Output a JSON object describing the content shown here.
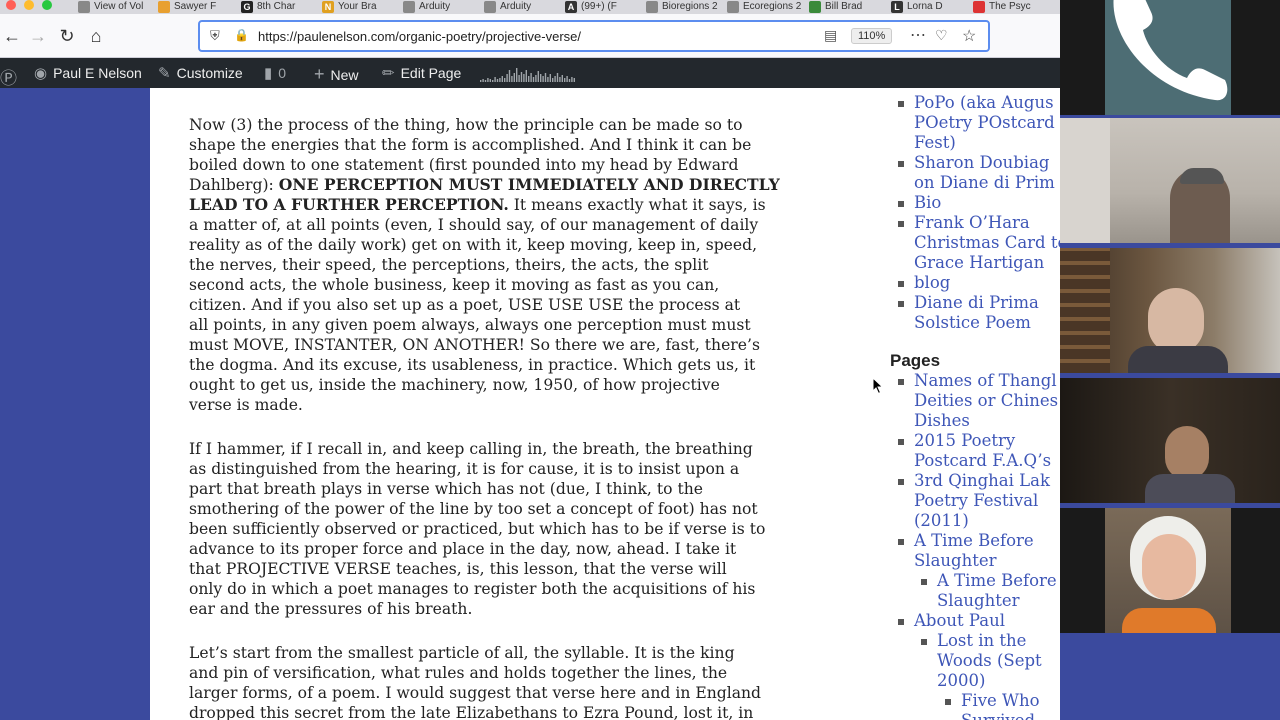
{
  "browser": {
    "tabs": [
      {
        "label": "View of Vol",
        "favicon": "",
        "color": "#888"
      },
      {
        "label": "Sawyer F",
        "favicon": "",
        "color": "#e8a030"
      },
      {
        "label": "8th Char",
        "favicon": "G",
        "color": "#222"
      },
      {
        "label": "Your Bra",
        "favicon": "N",
        "color": "#e0a020"
      },
      {
        "label": "Arduity",
        "favicon": "",
        "color": "#888"
      },
      {
        "label": "Arduity",
        "favicon": "",
        "color": "#888"
      },
      {
        "label": "(99+) (F",
        "favicon": "A",
        "color": "#333"
      },
      {
        "label": "Bioregions 2",
        "favicon": "",
        "color": "#888"
      },
      {
        "label": "Ecoregions 2",
        "favicon": "",
        "color": "#888"
      },
      {
        "label": "Bill Brad",
        "favicon": "",
        "color": "#3a8a3a"
      },
      {
        "label": "Lorna D",
        "favicon": "L",
        "color": "#333"
      },
      {
        "label": "The Psyc",
        "favicon": "",
        "color": "#d33"
      }
    ],
    "url": "https://paulenelson.com/organic-poetry/projective-verse/",
    "zoom": "110%"
  },
  "wpbar": {
    "site_name": "Paul E Nelson",
    "customize": "Customize",
    "comments": "0",
    "new": "New",
    "edit_page": "Edit Page"
  },
  "article": {
    "p1": [
      "Now (3) the process of the thing, how the principle can be made so to",
      "shape the energies that the form is accomplished. And I think it can be",
      "boiled down to one statement (first pounded into my head by Edward",
      "Dahlberg): ",
      "ONE PERCEPTION MUST IMMEDIATELY AND DIRECTLY",
      "LEAD TO A FURTHER PERCEPTION.",
      " It means exactly what it says, is",
      "a matter of, at all points (even, I should say, of our management of daily",
      "reality as of the daily work) get on with it, keep moving, keep in, speed,",
      "the nerves, their speed, the perceptions, theirs, the acts, the split",
      "second acts, the whole business, keep it moving as fast as you can,",
      "citizen. And if you also set up as a poet, USE USE USE the process at",
      "all points, in any given poem always, always one perception must must",
      "must MOVE, INSTANTER, ON ANOTHER! So there we are, fast, there’s",
      "the dogma. And its excuse, its usableness, in practice. Which gets us, it",
      "ought to get us, inside the machinery, now, 1950, of how projective",
      "verse is made."
    ],
    "p2": [
      "If I hammer, if I recall in, and keep calling in, the breath, the breathing",
      "as distinguished from the hearing, it is for cause, it is to insist upon a",
      "part that breath plays in verse which has not (due, I think, to the",
      "smothering of the power of the line by too set a concept of foot) has not",
      "been sufficiently observed or practiced, but which has to be if verse is to",
      "advance to its proper force and place in the day, now, ahead. I take it",
      "that PROJECTIVE VERSE teaches, is, this lesson, that the verse will",
      "only do in which a poet manages to register both the acquisitions of his",
      "ear and the pressures of his breath."
    ],
    "p3": [
      "Let’s start from the smallest particle of all, the syllable. It is the king",
      "and pin of versification, what rules and holds together the lines, the",
      "larger forms, of a poem. I would suggest that verse here and in England",
      "dropped this secret from the late Elizabethans to Ezra Pound, lost it, in"
    ]
  },
  "sidebar": {
    "recent": [
      [
        "PoPo (aka Augus",
        "POetry POstcard",
        "Fest)"
      ],
      [
        "Sharon Doubiag",
        "on Diane di Prim"
      ],
      [
        "Bio"
      ],
      [
        "Frank O’Hara",
        "Christmas Card to",
        "Grace Hartigan"
      ],
      [
        "blog"
      ],
      [
        "Diane di Prima",
        "Solstice Poem"
      ]
    ],
    "pages_heading": "Pages",
    "pages": [
      {
        "lines": [
          "Names of Thangl",
          "Deities or Chines",
          "Dishes"
        ],
        "level": 0
      },
      {
        "lines": [
          "2015 Poetry",
          "Postcard F.A.Q’s"
        ],
        "level": 0
      },
      {
        "lines": [
          "3rd Qinghai Lak",
          "Poetry Festival",
          "(2011)"
        ],
        "level": 0
      },
      {
        "lines": [
          "A Time Before",
          "Slaughter"
        ],
        "level": 0
      },
      {
        "lines": [
          "A Time Before",
          "Slaughter"
        ],
        "level": 1
      },
      {
        "lines": [
          "About Paul"
        ],
        "level": 0
      },
      {
        "lines": [
          "Lost in the",
          "Woods (Sept",
          "2000)"
        ],
        "level": 1
      },
      {
        "lines": [
          "Five Who",
          "Survived"
        ],
        "level": 2
      }
    ]
  },
  "colors": {
    "page_bg": "#3b4a9e",
    "link": "#3e56b7",
    "wpbar": "#23282d"
  }
}
